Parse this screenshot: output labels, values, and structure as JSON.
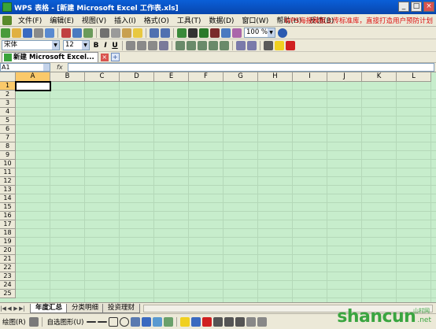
{
  "window": {
    "title": "WPS 表格 - [新建 Microsoft Excel 工作表.xls]",
    "buttons": [
      "_",
      "□",
      "×"
    ]
  },
  "menubar": {
    "items": [
      "文件(F)",
      "编辑(E)",
      "视图(V)",
      "插入(I)",
      "格式(O)",
      "工具(T)",
      "数据(D)",
      "窗口(W)",
      "帮助(H)",
      "反馈(B)"
    ],
    "promo": "WPS海报模板上传标准库，直接打造用户预防计划"
  },
  "toolbar": {
    "zoom": "100 %",
    "font_name": "宋体",
    "font_size": "12",
    "bold": "B",
    "italic": "I",
    "underline": "U"
  },
  "doc_tabs": {
    "active": "新建 Microsoft Excel...",
    "close": "×",
    "new": "+"
  },
  "formula_bar": {
    "name_box": "A1",
    "fx": "fx",
    "value": ""
  },
  "grid": {
    "columns": [
      "A",
      "B",
      "C",
      "D",
      "E",
      "F",
      "G",
      "H",
      "I",
      "J",
      "K",
      "L"
    ],
    "rows": [
      "1",
      "2",
      "3",
      "4",
      "5",
      "6",
      "7",
      "8",
      "9",
      "10",
      "11",
      "12",
      "13",
      "14",
      "15",
      "16",
      "17",
      "18",
      "19",
      "20",
      "21",
      "22",
      "23",
      "24",
      "25"
    ],
    "active_cell": "A1",
    "background": "#c7edcc",
    "header_highlight": "#fac96a"
  },
  "sheets": {
    "tabs": [
      "年度汇总",
      "分类明细",
      "投资理财"
    ],
    "active": "年度汇总"
  },
  "drawbar": {
    "draw_label": "绘图(R)",
    "autoshape_label": "自选图形(U)"
  },
  "watermark": {
    "brand": "shancun",
    "tld": ".net",
    "cn": "山村网"
  }
}
